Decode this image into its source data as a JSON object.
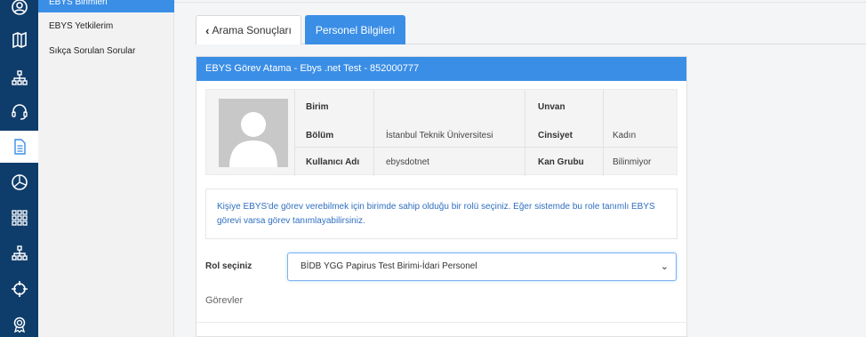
{
  "submenu": {
    "active_item": "EBYS Birimleri",
    "items": [
      "EBYS Yetkilerim",
      "Sıkça Sorulan Sorular"
    ]
  },
  "rail": {
    "icons": [
      "user-icon",
      "map-icon",
      "org-chart-icon",
      "headset-icon",
      "document-icon",
      "chart-icon",
      "grid-icon",
      "hierarchy-icon",
      "crosshair-icon",
      "award-icon"
    ],
    "active_index": 4
  },
  "tabs": {
    "back_label": "Arama Sonuçları",
    "active_label": "Personel Bilgileri"
  },
  "panel": {
    "title": "EBYS Görev Atama - Ebys .net Test - 852000777",
    "birim_label": "Birim",
    "birim_value": "",
    "bolum_label": "Bölüm",
    "bolum_value": "İstanbul Teknik Üniversitesi",
    "kullanici_label": "Kullanıcı Adı",
    "kullanici_value": "ebysdotnet",
    "unvan_label": "Unvan",
    "unvan_value": "",
    "cinsiyet_label": "Cinsiyet",
    "cinsiyet_value": "Kadın",
    "kan_label": "Kan Grubu",
    "kan_value": "Bilinmiyor",
    "alert_text": "Kişiye EBYS'de görev verebilmek için birimde sahip olduğu bir rolü seçiniz. Eğer sistemde bu role tanımlı EBYS görevi varsa görev tanımlayabilirsiniz.",
    "rol_label": "Rol seçiniz",
    "rol_selected": "BİDB YGG Papirus Test Birimi-İdari Personel",
    "gorevler_label": "Görevler"
  },
  "colors": {
    "rail_bg": "#0f3d6b",
    "accent": "#3a8ee6",
    "alert_text": "#2f6fc0"
  }
}
